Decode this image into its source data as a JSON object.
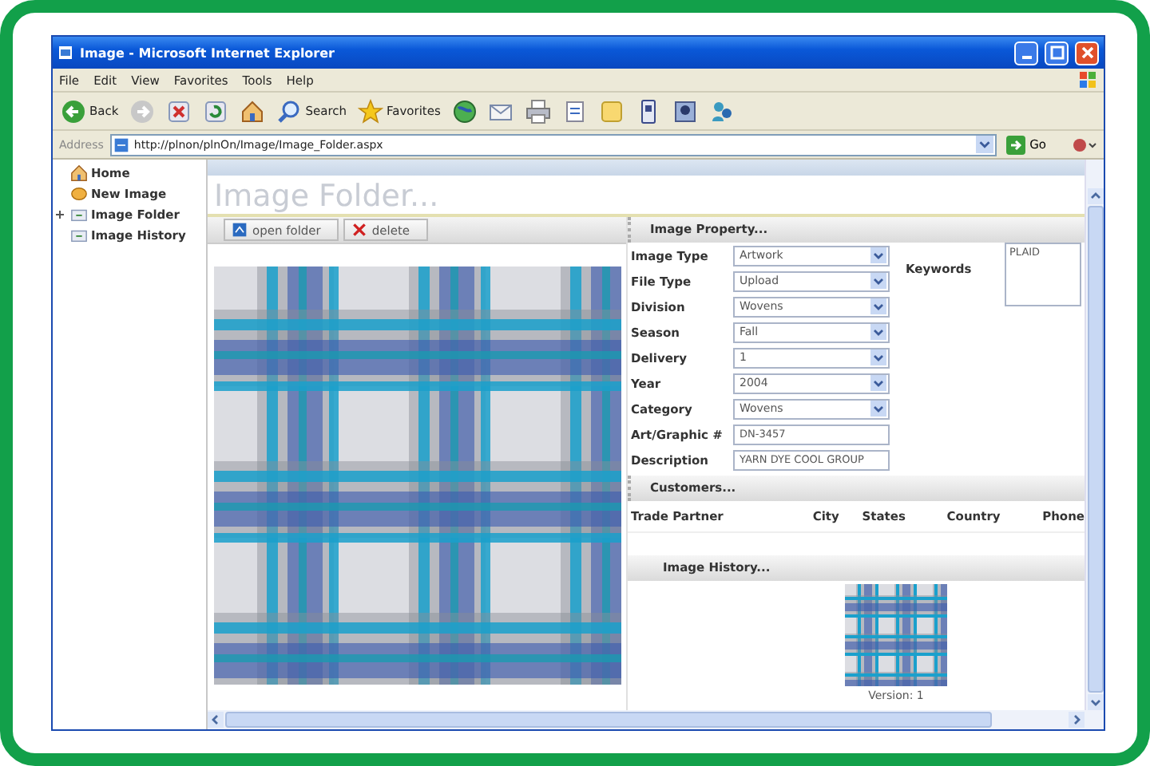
{
  "window": {
    "title": "Image - Microsoft Internet Explorer"
  },
  "menu": [
    "File",
    "Edit",
    "View",
    "Favorites",
    "Tools",
    "Help"
  ],
  "toolbar": [
    {
      "kind": "back",
      "label": "Back"
    },
    {
      "kind": "forward"
    },
    {
      "kind": "stop"
    },
    {
      "kind": "refresh"
    },
    {
      "kind": "home"
    },
    {
      "kind": "search",
      "label": "Search"
    },
    {
      "kind": "star",
      "label": "Favorites"
    },
    {
      "kind": "globe"
    },
    {
      "kind": "mail"
    },
    {
      "kind": "print"
    },
    {
      "kind": "doc"
    },
    {
      "kind": "note"
    },
    {
      "kind": "phone"
    },
    {
      "kind": "photo"
    },
    {
      "kind": "people"
    }
  ],
  "address": {
    "label": "Address",
    "url": "http://plnon/plnOn/Image/Image_Folder.aspx",
    "go": "Go"
  },
  "sidebar": {
    "items": [
      {
        "label": "Home",
        "kind": "home"
      },
      {
        "label": "New Image",
        "kind": "new"
      },
      {
        "label": "Image Folder",
        "kind": "node",
        "expanded": false
      },
      {
        "label": "Image History",
        "kind": "node"
      }
    ]
  },
  "page": {
    "title": "Image Folder...",
    "actions": [
      {
        "label": "open folder",
        "kind": "open"
      },
      {
        "label": "delete",
        "kind": "delete"
      }
    ],
    "property": {
      "header": "Image Property...",
      "fields": [
        {
          "label": "Image Type",
          "value": "Artwork",
          "kind": "select"
        },
        {
          "label": "File Type",
          "value": "Upload",
          "kind": "select"
        },
        {
          "label": "Division",
          "value": "Wovens",
          "kind": "select"
        },
        {
          "label": "Season",
          "value": "Fall",
          "kind": "select"
        },
        {
          "label": "Delivery",
          "value": "1",
          "kind": "select"
        },
        {
          "label": "Year",
          "value": "2004",
          "kind": "select"
        },
        {
          "label": "Category",
          "value": "Wovens",
          "kind": "select"
        },
        {
          "label": "Art/Graphic #",
          "value": "DN-3457",
          "kind": "text"
        },
        {
          "label": "Description",
          "value": "YARN DYE COOL GROUP",
          "kind": "text"
        }
      ],
      "keywords": {
        "label": "Keywords",
        "value": "PLAID"
      }
    },
    "customers": {
      "header": "Customers...",
      "columns": [
        "Trade Partner",
        "City",
        "States",
        "Country",
        "Phone"
      ]
    },
    "history": {
      "header": "Image History...",
      "version": "Version: 1"
    }
  }
}
